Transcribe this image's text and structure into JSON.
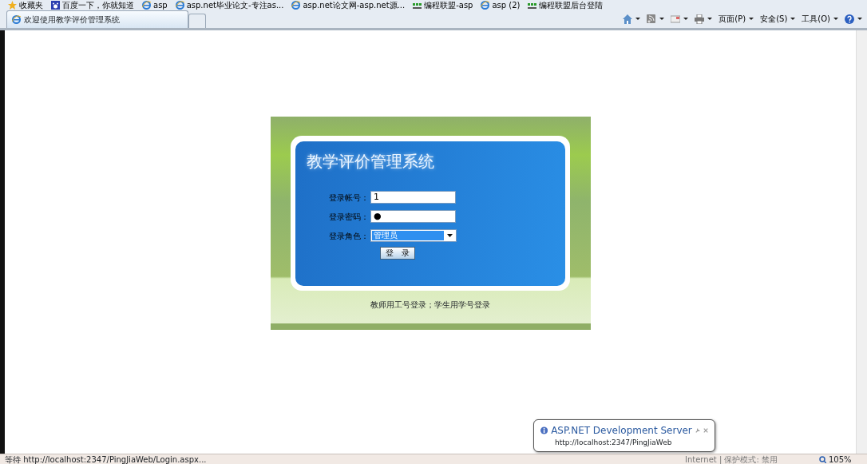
{
  "favorites_bar": [
    {
      "kind": "star",
      "label": "收藏夹"
    },
    {
      "kind": "baidu",
      "label": "百度一下，你就知道"
    },
    {
      "kind": "ie",
      "label": "asp"
    },
    {
      "kind": "ie",
      "label": "asp.net毕业论文-专注as..."
    },
    {
      "kind": "ie",
      "label": "asp.net论文网-asp.net源..."
    },
    {
      "kind": "web",
      "label": "编程联盟-asp"
    },
    {
      "kind": "ie",
      "label": "asp (2)"
    },
    {
      "kind": "web",
      "label": "编程联盟后台登陆"
    }
  ],
  "tabs": [
    {
      "label": "欢迎使用教学评价管理系统",
      "selected": true
    }
  ],
  "command_bar": [
    {
      "kind": "home"
    },
    {
      "kind": "feed"
    },
    {
      "kind": "mail"
    },
    {
      "kind": "print"
    },
    {
      "kind": "menu",
      "label": "页面(P)"
    },
    {
      "kind": "menu",
      "label": "安全(S)"
    },
    {
      "kind": "menu",
      "label": "工具(O)"
    },
    {
      "kind": "help"
    }
  ],
  "login": {
    "title": "教学评价管理系统",
    "fields": [
      {
        "kind": "text",
        "label": "登录帐号：",
        "value": "1"
      },
      {
        "kind": "text",
        "label": "登录密码：",
        "value": "●"
      },
      {
        "kind": "select",
        "label": "登录角色：",
        "value": "管理员"
      }
    ],
    "button": "登　录",
    "note": "教师用工号登录；学生用学号登录"
  },
  "status_bar": {
    "text": "等待 http://localhost:2347/PingJiaWeb/Login.aspx...",
    "zone": "Internet | 保护模式: 禁用",
    "zoom": "105%"
  },
  "notification": {
    "title": "ASP.NET Development Server",
    "text": "http://localhost:2347/PingJiaWeb"
  }
}
